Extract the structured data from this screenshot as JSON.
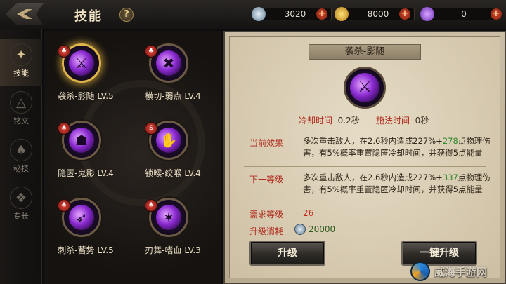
{
  "header": {
    "title": "技能",
    "help_label": "?",
    "resources": [
      {
        "name": "silver",
        "icon": "silver-coin-icon",
        "value": "3020",
        "plus": "+"
      },
      {
        "name": "gold",
        "icon": "gold-coin-icon",
        "value": "8000",
        "plus": "+"
      },
      {
        "name": "gem",
        "icon": "purple-gem-icon",
        "value": "0",
        "plus": "+"
      }
    ]
  },
  "nav": {
    "items": [
      {
        "label": "技能",
        "icon": "skill-book-icon",
        "active": true
      },
      {
        "label": "铭文",
        "icon": "inscription-icon",
        "active": false
      },
      {
        "label": "秘技",
        "icon": "secret-skill-icon",
        "active": false
      },
      {
        "label": "专长",
        "icon": "specialty-icon",
        "active": false
      }
    ]
  },
  "skills": [
    {
      "name": "袭杀-影随 LV.5",
      "badge": "♣",
      "selected": true
    },
    {
      "name": "横切-弱点 LV.4",
      "badge": "♣",
      "selected": false
    },
    {
      "name": "隐匿-鬼影 LV.4",
      "badge": "♣",
      "selected": false
    },
    {
      "name": "锁喉-绞喉 LV.4",
      "badge": "S",
      "selected": false
    },
    {
      "name": "刺杀-蓄势 LV.5",
      "badge": "♣",
      "selected": false
    },
    {
      "name": "刃舞-嗜血 LV.3",
      "badge": "♣",
      "selected": false
    }
  ],
  "detail": {
    "title": "袭杀-影随",
    "cooldown_label": "冷却时间",
    "cooldown_value": "0.2秒",
    "cast_label": "施法时间",
    "cast_value": "0秒",
    "current_label": "当前效果",
    "current_text_a": "多次重击敌人，在2.6秒内造成227%+",
    "current_num": "278",
    "current_text_b": "点物理伤害，有5%概率重置隐匿冷却时间，并获得5点能量",
    "next_label": "下一等级",
    "next_text_a": "多次重击敌人，在2.6秒内造成227%+",
    "next_num": "337",
    "next_text_b": "点物理伤害，有5%概率重置隐匿冷却时间，并获得5点能量",
    "need_label": "需求等级",
    "need_value": "26",
    "cost_label": "升级消耗",
    "cost_value": "20000",
    "upgrade_label": "升级",
    "upgrade_all_label": "一键升级"
  },
  "watermark": "威海手游网"
}
